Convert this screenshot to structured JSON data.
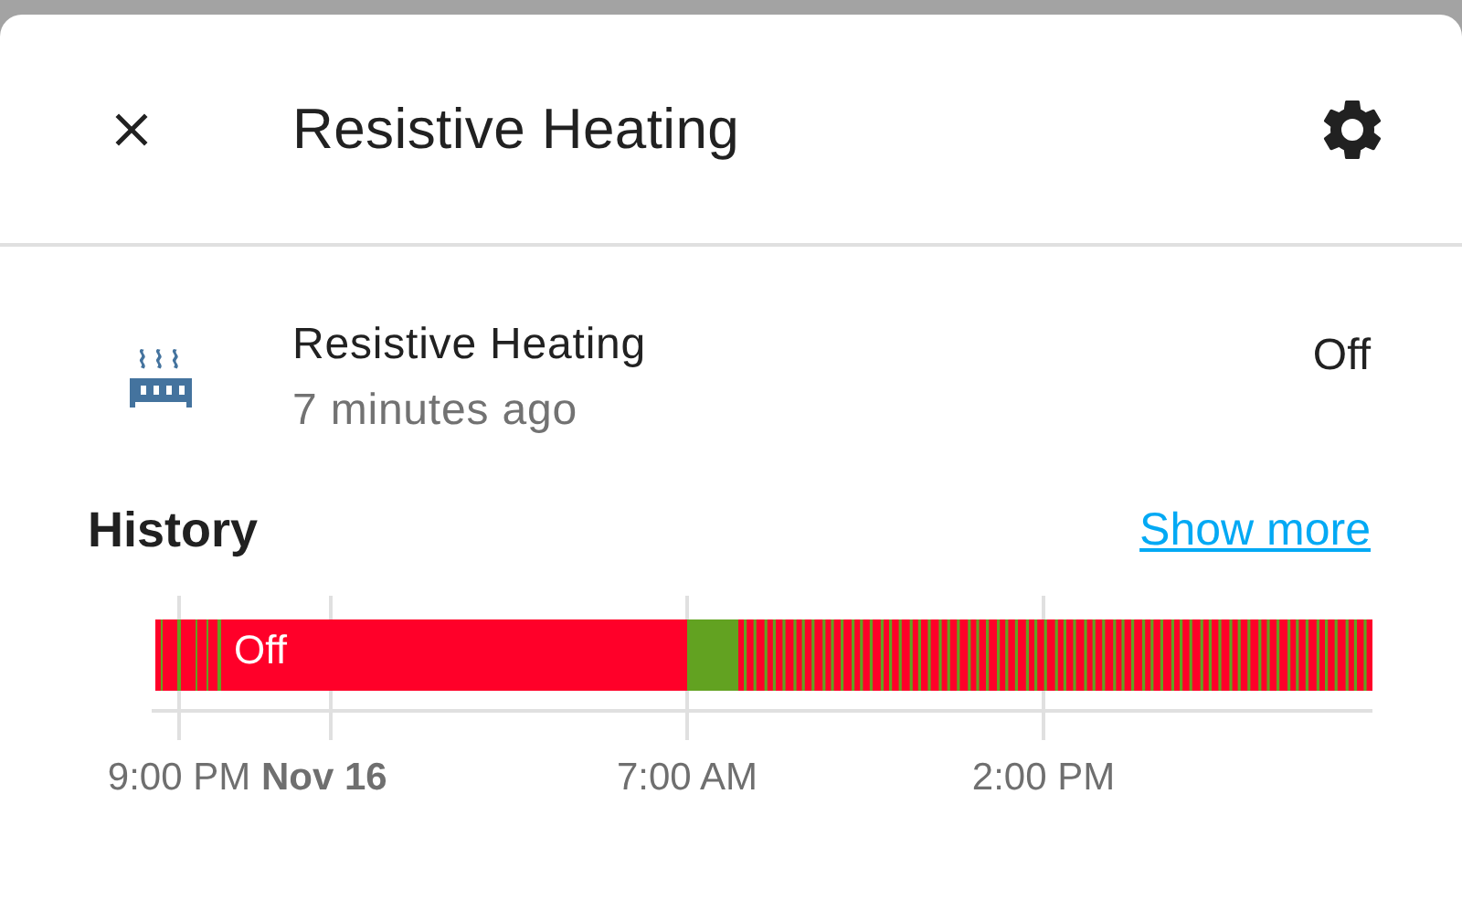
{
  "dialog": {
    "title": "Resistive Heating"
  },
  "entity": {
    "name": "Resistive Heating",
    "last_changed": "7 minutes ago",
    "state": "Off"
  },
  "history": {
    "title": "History",
    "link": "Show more",
    "bar_label": "Off",
    "ticks": [
      {
        "label": "9:00 PM",
        "kind": "minor"
      },
      {
        "label": "Nov 16",
        "kind": "major"
      },
      {
        "label": "7:00 AM",
        "kind": "minor"
      },
      {
        "label": "2:00 PM",
        "kind": "minor"
      }
    ]
  }
}
